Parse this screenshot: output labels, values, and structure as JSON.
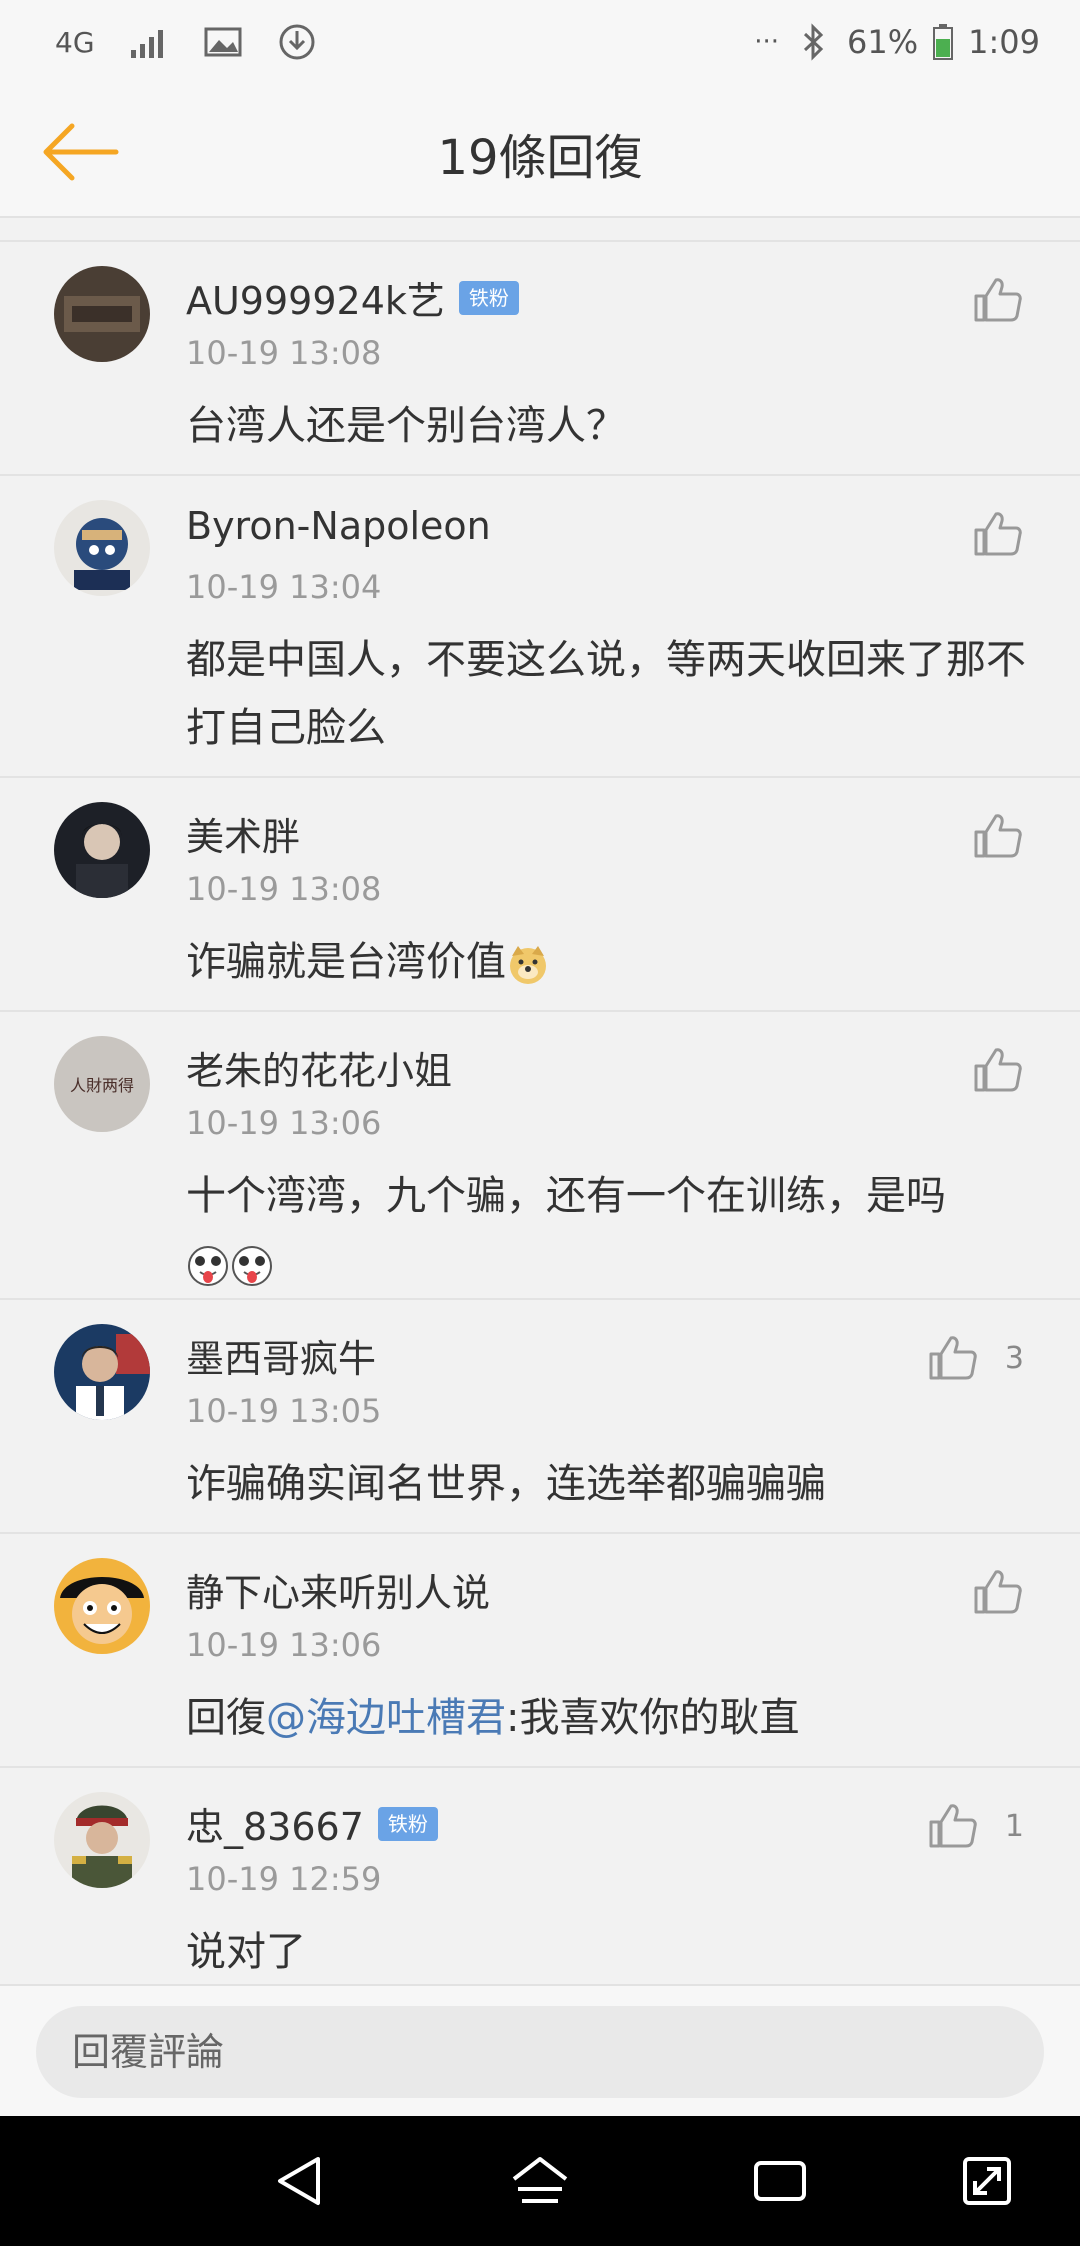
{
  "status_bar": {
    "network": "4G",
    "more": "···",
    "battery": "61%",
    "time": "1:09"
  },
  "header": {
    "title": "19條回復"
  },
  "comments": [
    {
      "username": "AU999924k艺",
      "badge": "铁粉",
      "time": "10-19 13:08",
      "text": "台湾人还是个别台湾人？",
      "likes": ""
    },
    {
      "username": "Byron-Napoleon",
      "badge": "",
      "time": "10-19 13:04",
      "text": "都是中国人，不要这么说，等两天收回来了那不打自己脸么",
      "likes": ""
    },
    {
      "username": "美术胖",
      "badge": "",
      "time": "10-19 13:08",
      "text": "诈骗就是台湾价值",
      "emoji": "doge-emoji",
      "likes": ""
    },
    {
      "username": "老朱的花花小姐",
      "badge": "",
      "avatar_text": "人財两得",
      "time": "10-19 13:06",
      "text": "十个湾湾，九个骗，还有一个在训练，是吗",
      "emoji": "tongue-emoji",
      "likes": ""
    },
    {
      "username": "墨西哥疯牛",
      "badge": "",
      "time": "10-19 13:05",
      "text": "诈骗确实闻名世界，连选举都骗骗骗",
      "likes": "3"
    },
    {
      "username": "静下心来听别人说",
      "badge": "",
      "time": "10-19 13:06",
      "text_prefix": "回復",
      "mention": "@海边吐槽君",
      "text_suffix": ":我喜欢你的耿直",
      "likes": ""
    },
    {
      "username": "忠_83667",
      "badge": "铁粉",
      "time": "10-19 12:59",
      "text": "说对了",
      "likes": "1"
    }
  ],
  "reply_bar": {
    "placeholder": "回覆評論"
  },
  "colors": {
    "accent": "#f5a623",
    "mention": "#4a7ab5",
    "badge": "#6aa3e6"
  }
}
